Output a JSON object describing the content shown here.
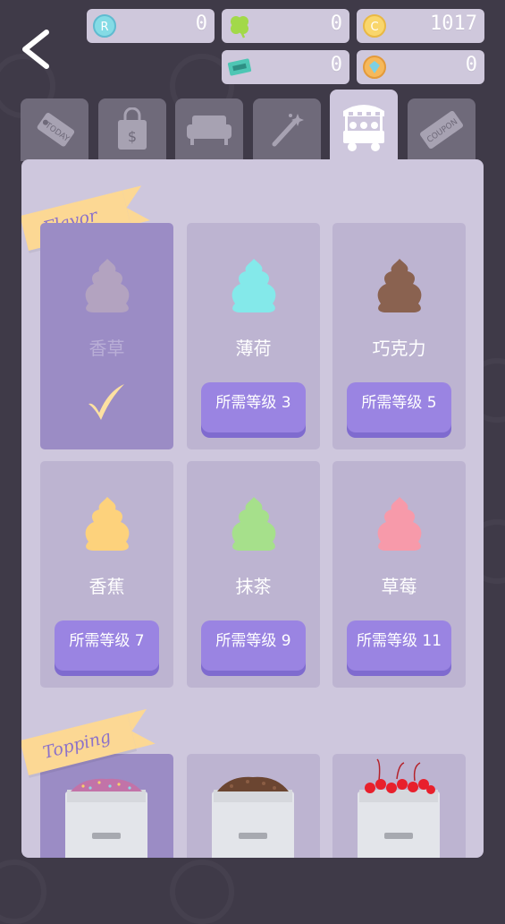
{
  "currency": {
    "r_coin": "0",
    "clover": "0",
    "gold_coin": "1017",
    "ticket": "0",
    "gem": "0"
  },
  "colors": {
    "vanilla": "#b3a3c0",
    "mint": "#84e9ea",
    "chocolate": "#8a6250",
    "banana": "#fdd27c",
    "matcha": "#a6e08b",
    "strawberry": "#f79aaa"
  },
  "tabs": [
    "today-icon",
    "shop-bag-icon",
    "sofa-icon",
    "magic-wand-icon",
    "ice-cream-cart-icon",
    "coupon-icon"
  ],
  "sections": {
    "flavor": "Flavor",
    "topping": "Topping"
  },
  "flavors": [
    {
      "name": "香草",
      "level": ""
    },
    {
      "name": "薄荷",
      "level": "所需等级 3"
    },
    {
      "name": "巧克力",
      "level": "所需等级 5"
    },
    {
      "name": "香蕉",
      "level": "所需等级 7"
    },
    {
      "name": "抹茶",
      "level": "所需等级 9"
    },
    {
      "name": "草莓",
      "level": "所需等级 11"
    }
  ],
  "toppings": [
    "sprinkles-icon",
    "chocolate-chips-icon",
    "cherries-icon"
  ]
}
